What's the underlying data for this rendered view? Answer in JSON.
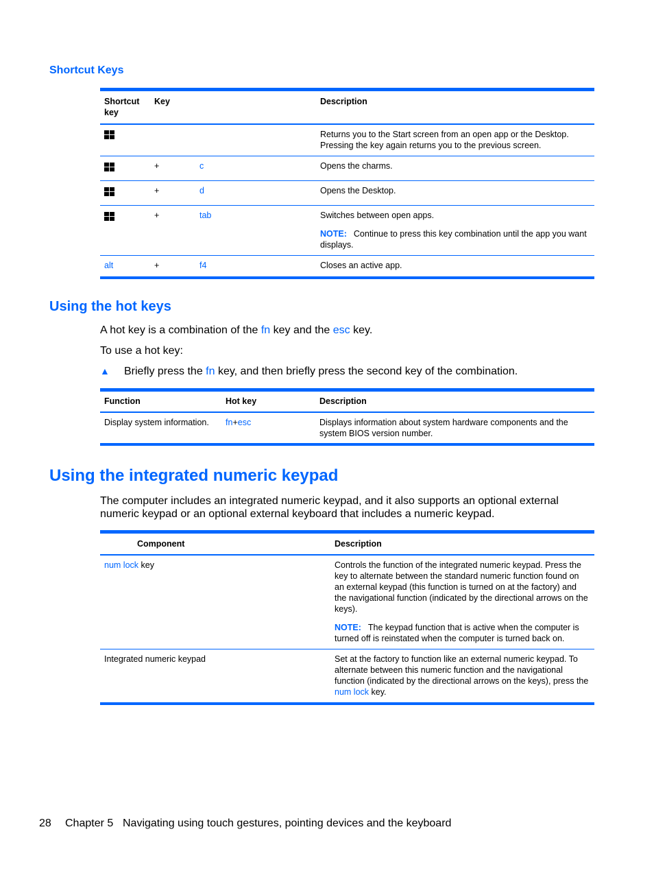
{
  "shortcut_section": {
    "title": "Shortcut Keys",
    "headers": [
      "Shortcut key",
      "Key",
      "Description"
    ],
    "rows": [
      {
        "shortcut_icon": "windows-key-icon",
        "plus": "",
        "key": "",
        "description": "Returns you to the Start screen from an open app or the Desktop. Pressing the key again returns you to the previous screen.",
        "note": ""
      },
      {
        "shortcut_icon": "windows-key-icon",
        "plus": "+",
        "key": "c",
        "description": "Opens the charms.",
        "note": ""
      },
      {
        "shortcut_icon": "windows-key-icon",
        "plus": "+",
        "key": "d",
        "description": "Opens the Desktop.",
        "note": ""
      },
      {
        "shortcut_icon": "windows-key-icon",
        "plus": "+",
        "key": "tab",
        "description": "Switches between open apps.",
        "note_label": "NOTE:",
        "note": "Continue to press this key combination until the app you want displays."
      },
      {
        "shortcut_text": "alt",
        "plus": "+",
        "key": "f4",
        "description": "Closes an active app.",
        "note": ""
      }
    ]
  },
  "hotkeys_section": {
    "title": "Using the hot keys",
    "intro": {
      "pre": "A hot key is a combination of the ",
      "key1": "fn",
      "mid": " key and the ",
      "key2": "esc",
      "post": " key."
    },
    "to_use": "To use a hot key:",
    "bullet_icon": "triangle-bullet-icon",
    "bullet": {
      "pre": "Briefly press the ",
      "key": "fn",
      "post": " key, and then briefly press the second key of the combination."
    },
    "headers": [
      "Function",
      "Hot key",
      "Description"
    ],
    "rows": [
      {
        "function": "Display system information.",
        "hotkey_a": "fn",
        "hotkey_plus": "+",
        "hotkey_b": "esc",
        "description": "Displays information about system hardware components and the system BIOS version number."
      }
    ]
  },
  "keypad_section": {
    "title": "Using the integrated numeric keypad",
    "intro": "The computer includes an integrated numeric keypad, and it also supports an optional external numeric keypad or an optional external keyboard that includes a numeric keypad.",
    "headers": [
      "Component",
      "Description"
    ],
    "rows": [
      {
        "component_key": "num lock",
        "component_suffix": " key",
        "description": "Controls the function of the integrated numeric keypad. Press the key to alternate between the standard numeric function found on an external keypad (this function is turned on at the factory) and the navigational function (indicated by the directional arrows on the keys).",
        "note_label": "NOTE:",
        "note": "The keypad function that is active when the computer is turned off is reinstated when the computer is turned back on."
      },
      {
        "component": "Integrated numeric keypad",
        "description_pre": "Set at the factory to function like an external numeric keypad. To alternate between this numeric function and the navigational function (indicated by the directional arrows on the keys), press the ",
        "description_key": "num lock",
        "description_post": " key."
      }
    ]
  },
  "footer": {
    "page_number": "28",
    "chapter": "Chapter 5",
    "chapter_title": "Navigating using touch gestures, pointing devices and the keyboard"
  }
}
